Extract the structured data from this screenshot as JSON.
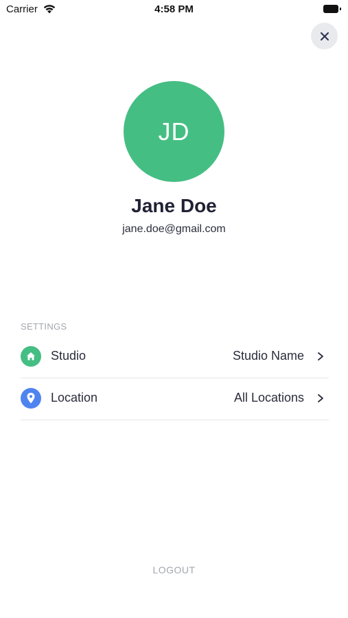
{
  "status_bar": {
    "carrier": "Carrier",
    "time": "4:58 PM"
  },
  "profile": {
    "initials": "JD",
    "name": "Jane Doe",
    "email": "jane.doe@gmail.com",
    "avatar_color": "#45be83"
  },
  "settings": {
    "section_label": "SETTINGS",
    "rows": [
      {
        "label": "Studio",
        "value": "Studio Name",
        "icon": "home-icon",
        "icon_color": "#45be83"
      },
      {
        "label": "Location",
        "value": "All Locations",
        "icon": "location-pin-icon",
        "icon_color": "#4f84f0"
      }
    ]
  },
  "logout_label": "LOGOUT"
}
